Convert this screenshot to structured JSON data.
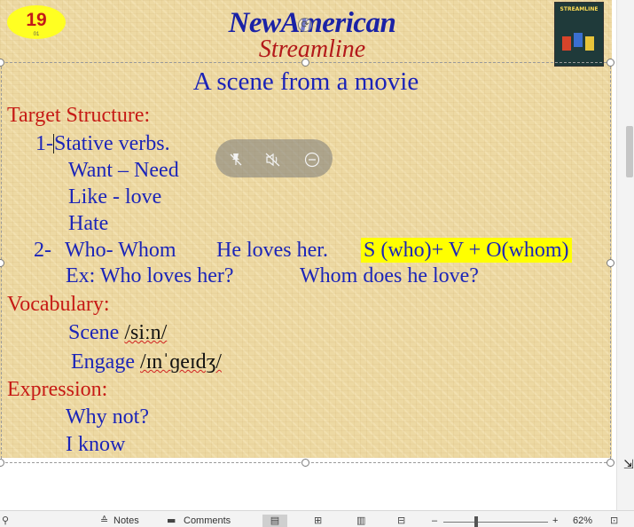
{
  "slide": {
    "number": "19",
    "number_sub": "01",
    "logo_line1": "NewAmerican",
    "logo_line2": "Streamline",
    "book_title": "STREAMLINE",
    "title": "A scene from a movie",
    "target_structure": {
      "heading": "Target Structure:",
      "item1_num": "1-",
      "item1_text": "Stative verbs.",
      "line_want_need": "Want – Need",
      "line_like_love": "Like   -  love",
      "line_hate": "Hate",
      "item2_num": "2-",
      "item2_text": "Who- Whom",
      "item2_example": "He loves her.",
      "item2_formula": "S (who)+ V + O(whom)",
      "ex_line1": "Ex: Who loves her?",
      "ex_line2": "Whom does he love?"
    },
    "vocabulary": {
      "heading": "Vocabulary:",
      "word1": "Scene",
      "ipa1": "/siːn/",
      "word2": "Engage",
      "ipa2": "/ɪnˈɡeɪdʒ/"
    },
    "expression": {
      "heading": "Expression:",
      "line1": "Why not?",
      "line2": "I know"
    }
  },
  "media_toolbar": {
    "icons": [
      "pin-off-icon",
      "mute-icon",
      "minimize-icon"
    ]
  },
  "statusbar": {
    "notes_label": "Notes",
    "comments_label": "Comments",
    "zoom_level": "62%",
    "zoom_minus": "–",
    "zoom_plus": "+"
  },
  "colors": {
    "heading_red": "#c61a15",
    "text_blue": "#1c25b8",
    "highlight": "#ffff00",
    "badge": "#ffff22"
  }
}
